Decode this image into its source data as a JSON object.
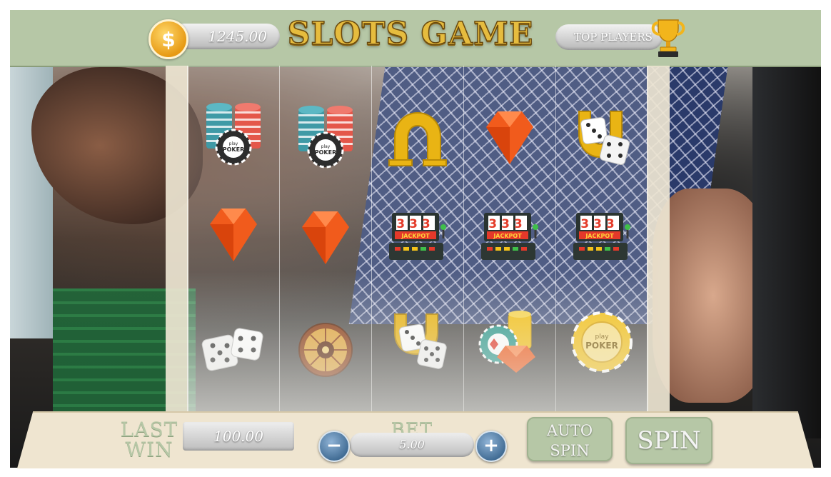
{
  "header": {
    "balance": "1245.00",
    "currency_symbol": "$",
    "title": "SLOTS GAME",
    "top_players_label": "TOP PLAYERS"
  },
  "reels": [
    [
      "chips",
      "diamond",
      "dice"
    ],
    [
      "chips",
      "diamond",
      "roulette"
    ],
    [
      "horseshoe",
      "jackpot-slot",
      "horseshoe-dice"
    ],
    [
      "diamond",
      "jackpot-slot",
      "chips-cards-diamond"
    ],
    [
      "horseshoe-dice",
      "jackpot-slot",
      "poker-chip"
    ]
  ],
  "symbols": {
    "jackpot_digits": "333",
    "jackpot_label": "JACKPOT",
    "poker_play": "play",
    "poker_word": "POKER"
  },
  "controls": {
    "last_win_label_1": "LAST",
    "last_win_label_2": "WIN",
    "last_win_value": "100.00",
    "bet_label": "BET",
    "bet_value": "5.00",
    "minus_label": "−",
    "plus_label": "+",
    "auto_spin_label_1": "AUTO",
    "auto_spin_label_2": "SPIN",
    "spin_label": "SPIN"
  },
  "colors": {
    "header_bg": "#b6c7a6",
    "title_gold": "#e6bc3e",
    "panel_bg": "#efe5d0",
    "button_green": "#b6c7a6"
  }
}
